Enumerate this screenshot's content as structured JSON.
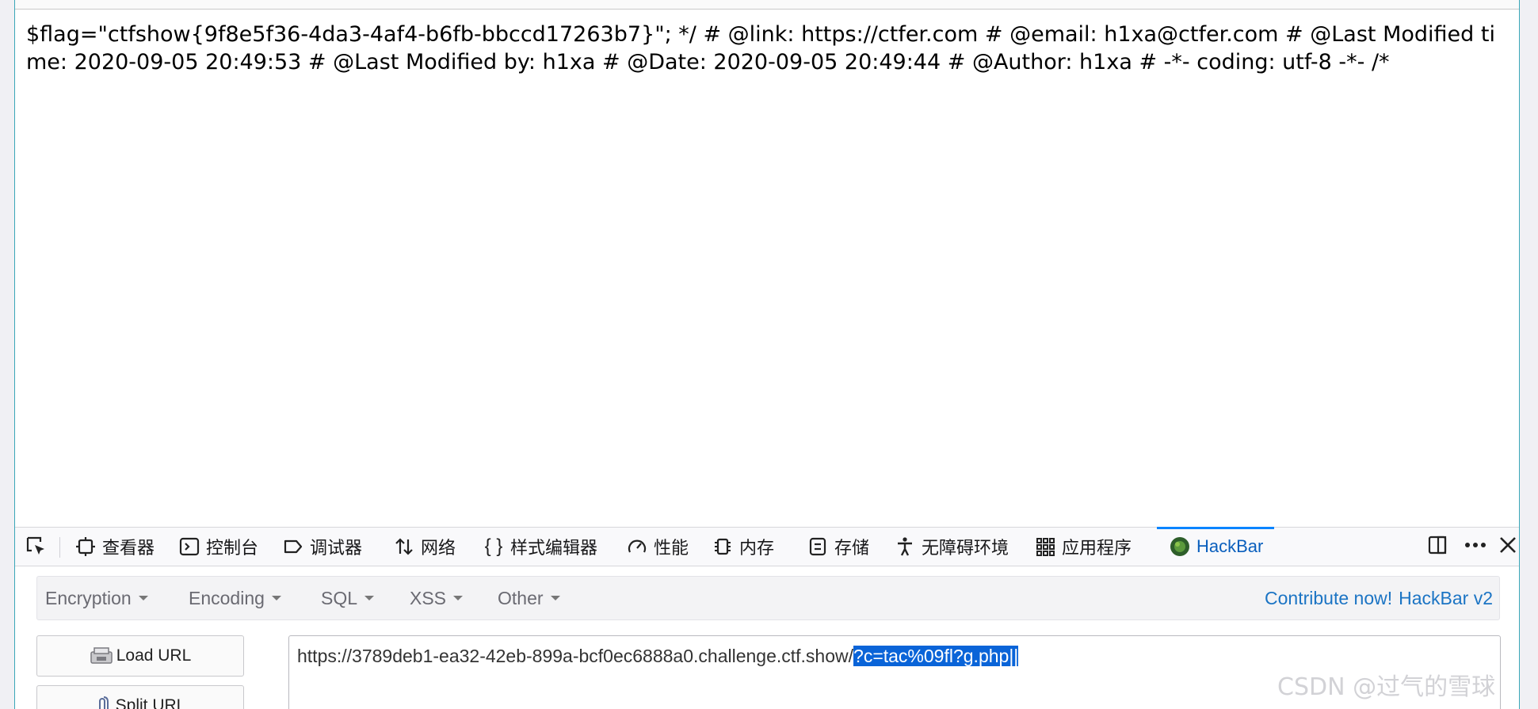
{
  "page": {
    "content_text": "$flag=\"ctfshow{9f8e5f36-4da3-4af4-b6fb-bbccd17263b7}\"; */ # @link: https://ctfer.com # @email: h1xa@ctfer.com # @Last Modified time: 2020-09-05 20:49:53 # @Last Modified by: h1xa # @Date: 2020-09-05 20:49:44 # @Author: h1xa # -*- coding: utf-8 -*- /*"
  },
  "devtools": {
    "tabs": [
      {
        "label": "查看器",
        "icon": "inspector-icon"
      },
      {
        "label": "控制台",
        "icon": "console-icon"
      },
      {
        "label": "调试器",
        "icon": "debugger-icon"
      },
      {
        "label": "网络",
        "icon": "network-icon"
      },
      {
        "label": "样式编辑器",
        "icon": "style-editor-icon"
      },
      {
        "label": "性能",
        "icon": "performance-icon"
      },
      {
        "label": "内存",
        "icon": "memory-icon"
      },
      {
        "label": "存储",
        "icon": "storage-icon"
      },
      {
        "label": "无障碍环境",
        "icon": "accessibility-icon"
      },
      {
        "label": "应用程序",
        "icon": "application-icon"
      },
      {
        "label": "HackBar",
        "icon": "hackbar-icon",
        "active": true
      }
    ],
    "accent_color": "#0a84ff"
  },
  "hackbar": {
    "menus": [
      "Encryption",
      "Encoding",
      "SQL",
      "XSS",
      "Other"
    ],
    "contribute_label": "Contribute now!",
    "version_label": "HackBar v2",
    "load_url_label": "Load URL",
    "split_url_label": "Split URL",
    "url_prefix": "https://3789deb1-ea32-42eb-899a-bcf0ec6888a0.challenge.ctf.show/",
    "url_selected": "?c=tac%09fl?g.php||",
    "selection_color": "#0a64d8"
  },
  "watermark": "CSDN @过气的雪球"
}
